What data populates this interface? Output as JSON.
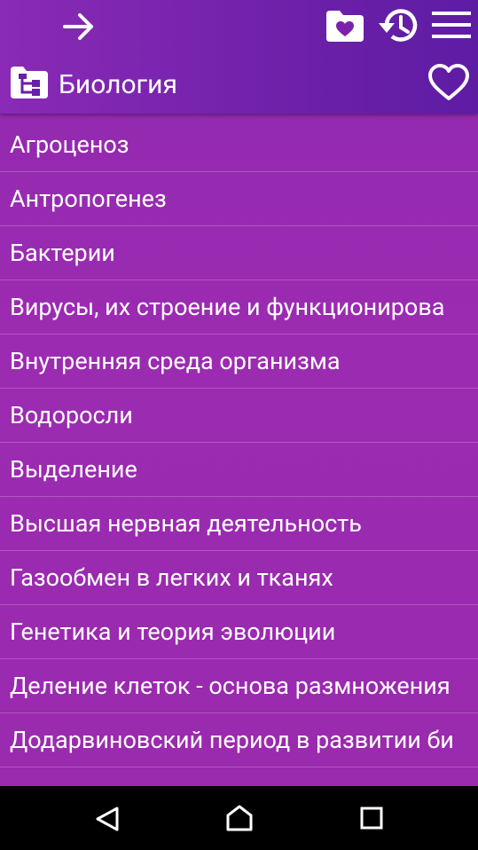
{
  "header": {
    "title": "Биология"
  },
  "icons": {
    "forward": "arrow-right-icon",
    "favorites_folder": "folder-heart-icon",
    "history": "history-icon",
    "menu": "hamburger-menu-icon",
    "category": "folder-tree-icon",
    "favorite": "heart-outline-icon"
  },
  "list": {
    "items": [
      "Агроценоз",
      "Антропогенез",
      "Бактерии",
      "Вирусы, их строение и функционирова",
      "Внутренняя среда организма",
      "Водоросли",
      "Выделение",
      "Высшая нервная деятельность",
      "Газообмен в легких и тканях",
      "Генетика и теория эволюции",
      "Деление клеток - основа размножения",
      "Додарвиновский период в развитии би",
      ""
    ]
  },
  "colors": {
    "toolbar": "#6a1fa8",
    "list_background": "#9b2bb1",
    "text": "#ffffff"
  }
}
